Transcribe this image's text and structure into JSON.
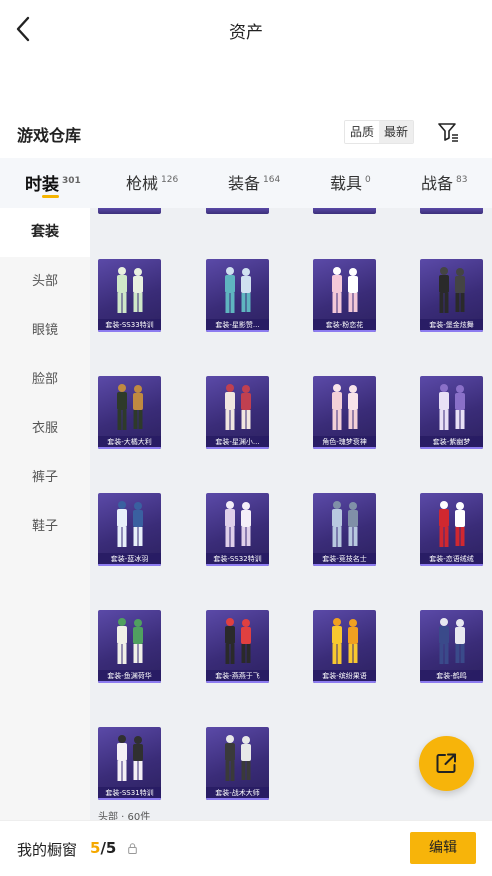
{
  "header": {
    "title": "资产"
  },
  "section": {
    "title": "游戏仓库",
    "sort_options": [
      "品质",
      "最新"
    ],
    "active_sort": "最新"
  },
  "tabs": [
    {
      "label": "时装",
      "count": "301",
      "active": true
    },
    {
      "label": "枪械",
      "count": "126",
      "active": false
    },
    {
      "label": "装备",
      "count": "164",
      "active": false
    },
    {
      "label": "载具",
      "count": "0",
      "active": false
    },
    {
      "label": "战备",
      "count": "83",
      "active": false
    }
  ],
  "sidebar": {
    "items": [
      {
        "label": "套装",
        "active": true
      },
      {
        "label": "头部"
      },
      {
        "label": "眼镜"
      },
      {
        "label": "脸部"
      },
      {
        "label": "衣服"
      },
      {
        "label": "裤子"
      },
      {
        "label": "鞋子"
      }
    ]
  },
  "items": [
    {
      "name": "套装-SS33特训"
    },
    {
      "name": "套装-星影赞..."
    },
    {
      "name": "套装-粉恋花"
    },
    {
      "name": "套装-堡金炫舞"
    },
    {
      "name": "套装-大橘大利"
    },
    {
      "name": "套装-星渊小..."
    },
    {
      "name": "角色-瑰梦衰神"
    },
    {
      "name": "套装-紫幽梦"
    },
    {
      "name": "套装-蓝冰羽"
    },
    {
      "name": "套装-SS32特训"
    },
    {
      "name": "套装-竞技名士"
    },
    {
      "name": "套装-恋语绒绒"
    },
    {
      "name": "套装-鱼渊荷华"
    },
    {
      "name": "套装-燕燕于飞"
    },
    {
      "name": "套装-缤纷果语"
    },
    {
      "name": "套装-鹤鸣"
    },
    {
      "name": "套装-SS31特训"
    },
    {
      "name": "套装-战术大师"
    }
  ],
  "grid_footer": "头部 · 60件",
  "bottom": {
    "label": "我的橱窗",
    "current": "5",
    "total": "/5",
    "edit_label": "编辑"
  },
  "colors": {
    "accent": "#f7b40a",
    "card_bg": "#3a2c78",
    "highlight": "#f5a800"
  },
  "icons": {
    "back": "chevron-left-icon",
    "filter": "filter-icon",
    "share": "external-link-icon",
    "lock": "lock-icon"
  }
}
